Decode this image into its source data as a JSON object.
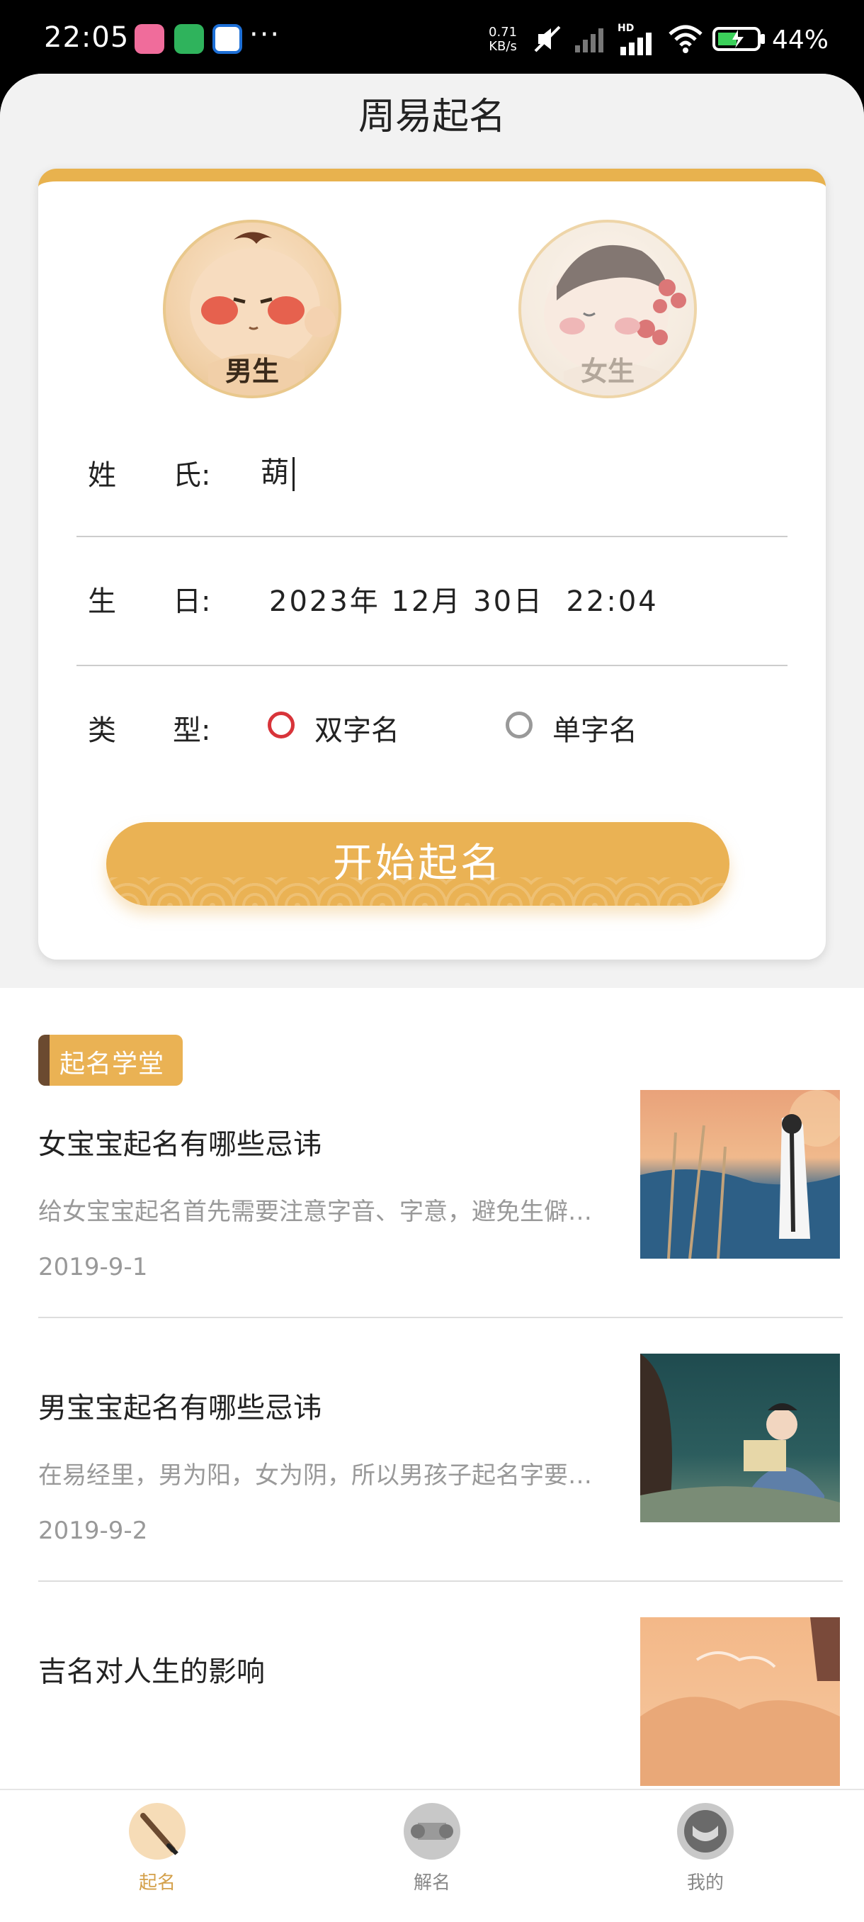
{
  "status_bar": {
    "time": "22:05",
    "dots": "···",
    "speed_value": "0.71",
    "speed_unit": "KB/s",
    "battery": "44%",
    "network": "HD"
  },
  "header": {
    "title": "周易起名"
  },
  "gender": {
    "boy_label": "男生",
    "girl_label": "女生",
    "selected": "boy"
  },
  "form": {
    "surname_label": "姓　　氏:",
    "surname_value": "葫",
    "birthday_label": "生　　日:",
    "birthday_value": "2023年 12月 30日  22:04",
    "type_label": "类　　型:",
    "type_options": [
      "双字名",
      "单字名"
    ],
    "type_selected": "双字名",
    "start_button": "开始起名"
  },
  "school": {
    "tag": "起名学堂",
    "articles": [
      {
        "title": "女宝宝起名有哪些忌讳",
        "desc": "给女宝宝起名首先需要注意字音、字意，避免生僻…",
        "date": "2019-9-1"
      },
      {
        "title": "男宝宝起名有哪些忌讳",
        "desc": "在易经里，男为阳，女为阴，所以男孩子起名字要…",
        "date": "2019-9-2"
      },
      {
        "title": "吉名对人生的影响",
        "desc": "",
        "date": ""
      }
    ]
  },
  "tabs": [
    {
      "label": "起名",
      "active": true
    },
    {
      "label": "解名",
      "active": false
    },
    {
      "label": "我的",
      "active": false
    }
  ],
  "colors": {
    "accent": "#eab254",
    "radio_on": "#d8343a",
    "tab_active": "#d4a04a",
    "tab_inactive": "#888888"
  }
}
